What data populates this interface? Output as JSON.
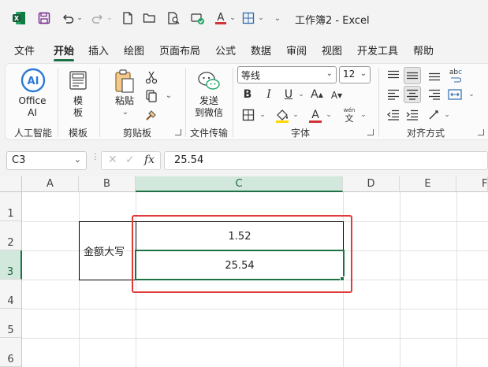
{
  "window": {
    "title": "工作簿2  -  Excel"
  },
  "tabs": [
    "文件",
    "开始",
    "插入",
    "绘图",
    "页面布局",
    "公式",
    "数据",
    "审阅",
    "视图",
    "开发工具",
    "帮助"
  ],
  "active_tab": "开始",
  "ribbon": {
    "office_ai_label_1": "Office",
    "office_ai_label_2": "AI",
    "template_label_1": "模",
    "template_label_2": "板",
    "paste_label": "粘贴",
    "send_label_1": "发送",
    "send_label_2": "到微信",
    "font_name": "等线",
    "font_size": "12",
    "bold": "B",
    "italic": "I",
    "underline": "U",
    "font_grow": "A",
    "font_shrink": "A",
    "font_color_glyph": "A",
    "phonetic_top": "wén",
    "phonetic_bottom": "文",
    "wrap_glyph": "ab",
    "wrap_glyph_2": "c",
    "group_labels": {
      "ai": "人工智能",
      "template": "模板",
      "clipboard": "剪贴板",
      "file_transfer": "文件传输",
      "font": "字体",
      "alignment": "对齐方式"
    }
  },
  "formula_bar": {
    "name_box": "C3",
    "fx": "fx",
    "formula": "25.54"
  },
  "sheet": {
    "columns": [
      "A",
      "B",
      "C",
      "D",
      "E",
      "F"
    ],
    "rows": [
      "1",
      "2",
      "3",
      "4",
      "5",
      "6"
    ],
    "selected_column": "C",
    "selected_row": "3",
    "cells": {
      "B2": "金额大写",
      "C2": "1.52",
      "C3": "25.54"
    }
  },
  "colors": {
    "accent": "#1e7145",
    "highlight_box": "#e03a3a",
    "font_color": "#d13438",
    "fill_color": "#ffd700"
  }
}
